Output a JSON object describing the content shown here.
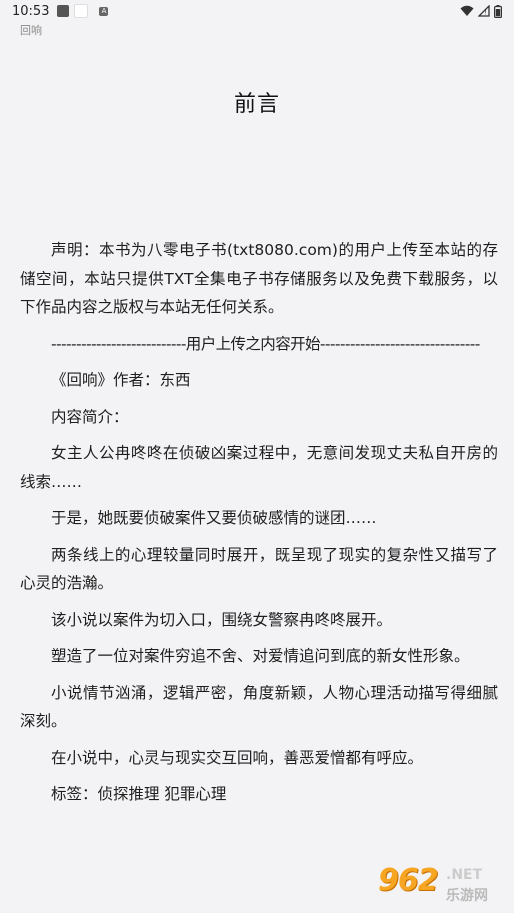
{
  "status_bar": {
    "time": "10:53",
    "notif_icon_label": "A",
    "icons": [
      "app-square-icon",
      "app-square-white-icon",
      "a-notification-icon",
      "wifi-icon",
      "signal-icon",
      "battery-icon"
    ]
  },
  "reader": {
    "book_name": "回响",
    "chapter_title": "前言",
    "paragraphs": [
      "声明：本书为八零电子书(txt8080.com)的用户上传至本站的存储空间，本站只提供TXT全集电子书存储服务以及免费下载服务，以下作品内容之版权与本站无任何关系。",
      "---------------------------用户上传之内容开始--------------------------------",
      "《回响》作者：东西",
      "内容简介：",
      "女主人公冉咚咚在侦破凶案过程中，无意间发现丈夫私自开房的线索……",
      "于是，她既要侦破案件又要侦破感情的谜团……",
      "两条线上的心理较量同时展开，既呈现了现实的复杂性又描写了心灵的浩瀚。",
      "该小说以案件为切入口，围绕女警察冉咚咚展开。",
      "塑造了一位对案件穷追不舍、对爱情追问到底的新女性形象。",
      "小说情节汹涌，逻辑严密，角度新颖，人物心理活动描写得细腻深刻。",
      "在小说中，心灵与现实交互回响，善恶爱憎都有呼应。",
      "标签：侦探推理 犯罪心理"
    ]
  },
  "watermark": {
    "number": "962",
    "suffix": ".NET",
    "site": "乐游网"
  }
}
